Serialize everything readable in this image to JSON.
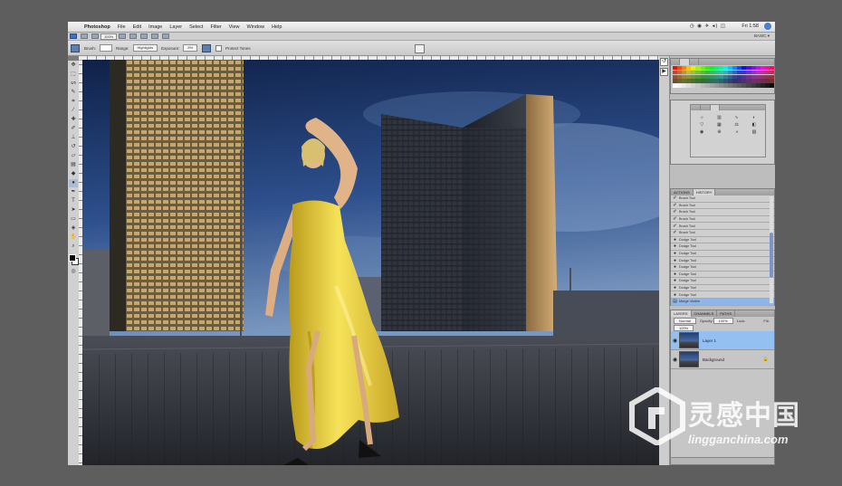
{
  "menubar": {
    "apple": "",
    "items": [
      "Photoshop",
      "File",
      "Edit",
      "Image",
      "Layer",
      "Select",
      "Filter",
      "View",
      "Window",
      "Help"
    ],
    "status": "◷ ◉ ✈ ◂) ◫",
    "clock": "Fri 1:58"
  },
  "appbar": {
    "zoom": "100%",
    "workspace_label": "BASIC ▾"
  },
  "options": {
    "brush_label": "Brush:",
    "mode_label": "Range:",
    "mode_value": "Highlights",
    "exposure_label": "Exposure:",
    "exposure_value": "8%",
    "protect_label": "Protect Tones"
  },
  "history": {
    "tabs": [
      "ACTIONS",
      "HISTORY"
    ],
    "rows": [
      "Brush Tool",
      "Brush Tool",
      "Brush Tool",
      "Brush Tool",
      "Brush Tool",
      "Brush Tool",
      "Dodge Tool",
      "Dodge Tool",
      "Dodge Tool",
      "Dodge Tool",
      "Dodge Tool",
      "Dodge Tool",
      "Dodge Tool",
      "Dodge Tool",
      "Dodge Tool",
      "Merge Visible"
    ]
  },
  "layers": {
    "tabs": [
      "LAYERS",
      "CHANNELS",
      "PATHS"
    ],
    "blend_mode": "Normal",
    "opacity_label": "Opacity:",
    "opacity_value": "100%",
    "lock_label": "Lock:",
    "fill_label": "Fill:",
    "fill_value": "100%",
    "items": [
      {
        "name": "Layer 1",
        "selected": true
      },
      {
        "name": "Background",
        "selected": false
      }
    ]
  },
  "colors": {
    "accent": "#3e72c2",
    "selection": "#93c0f0",
    "sky_top": "#13254f",
    "sky_bottom": "#5f84b3"
  },
  "watermark": {
    "cn": "灵感中国",
    "en": "lingganchina.com"
  }
}
